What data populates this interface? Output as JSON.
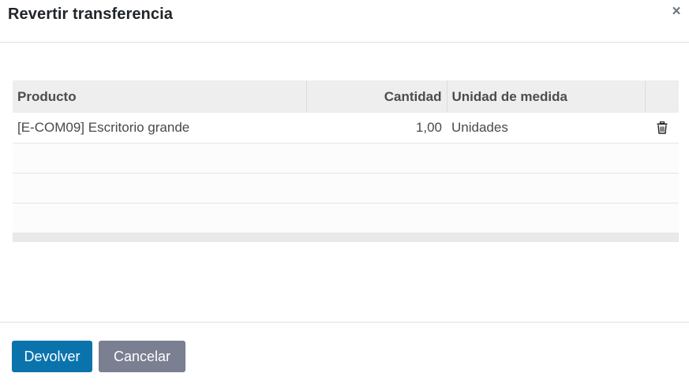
{
  "dialog": {
    "title": "Revertir transferencia",
    "close_symbol": "×"
  },
  "table": {
    "columns": [
      "Producto",
      "Cantidad",
      "Unidad de medida",
      ""
    ],
    "rows": [
      {
        "product": "[E-COM09] Escritorio grande",
        "quantity": "1,00",
        "uom": "Unidades",
        "action_icon": "trash-icon"
      }
    ]
  },
  "footer": {
    "primary_label": "Devolver",
    "secondary_label": "Cancelar"
  },
  "colors": {
    "primary": "#0a73ac",
    "secondary": "#7a7f91",
    "header_bg": "#eeeeee"
  }
}
